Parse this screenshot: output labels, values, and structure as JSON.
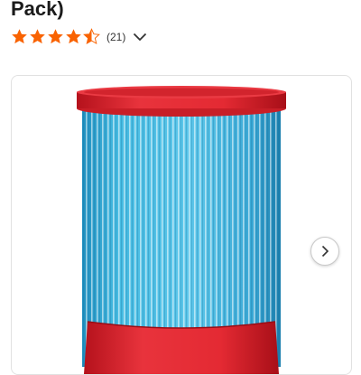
{
  "product": {
    "title_fragment": "Pack)",
    "rating": {
      "stars": 4.5,
      "max": 5,
      "review_count": "(21)"
    }
  },
  "colors": {
    "star": "#f96302",
    "filter_blue": "#3cb4e0",
    "filter_red": "#e0252f"
  },
  "icons": {
    "rating_expand": "chevron-down-icon",
    "gallery_next": "chevron-right-icon"
  }
}
